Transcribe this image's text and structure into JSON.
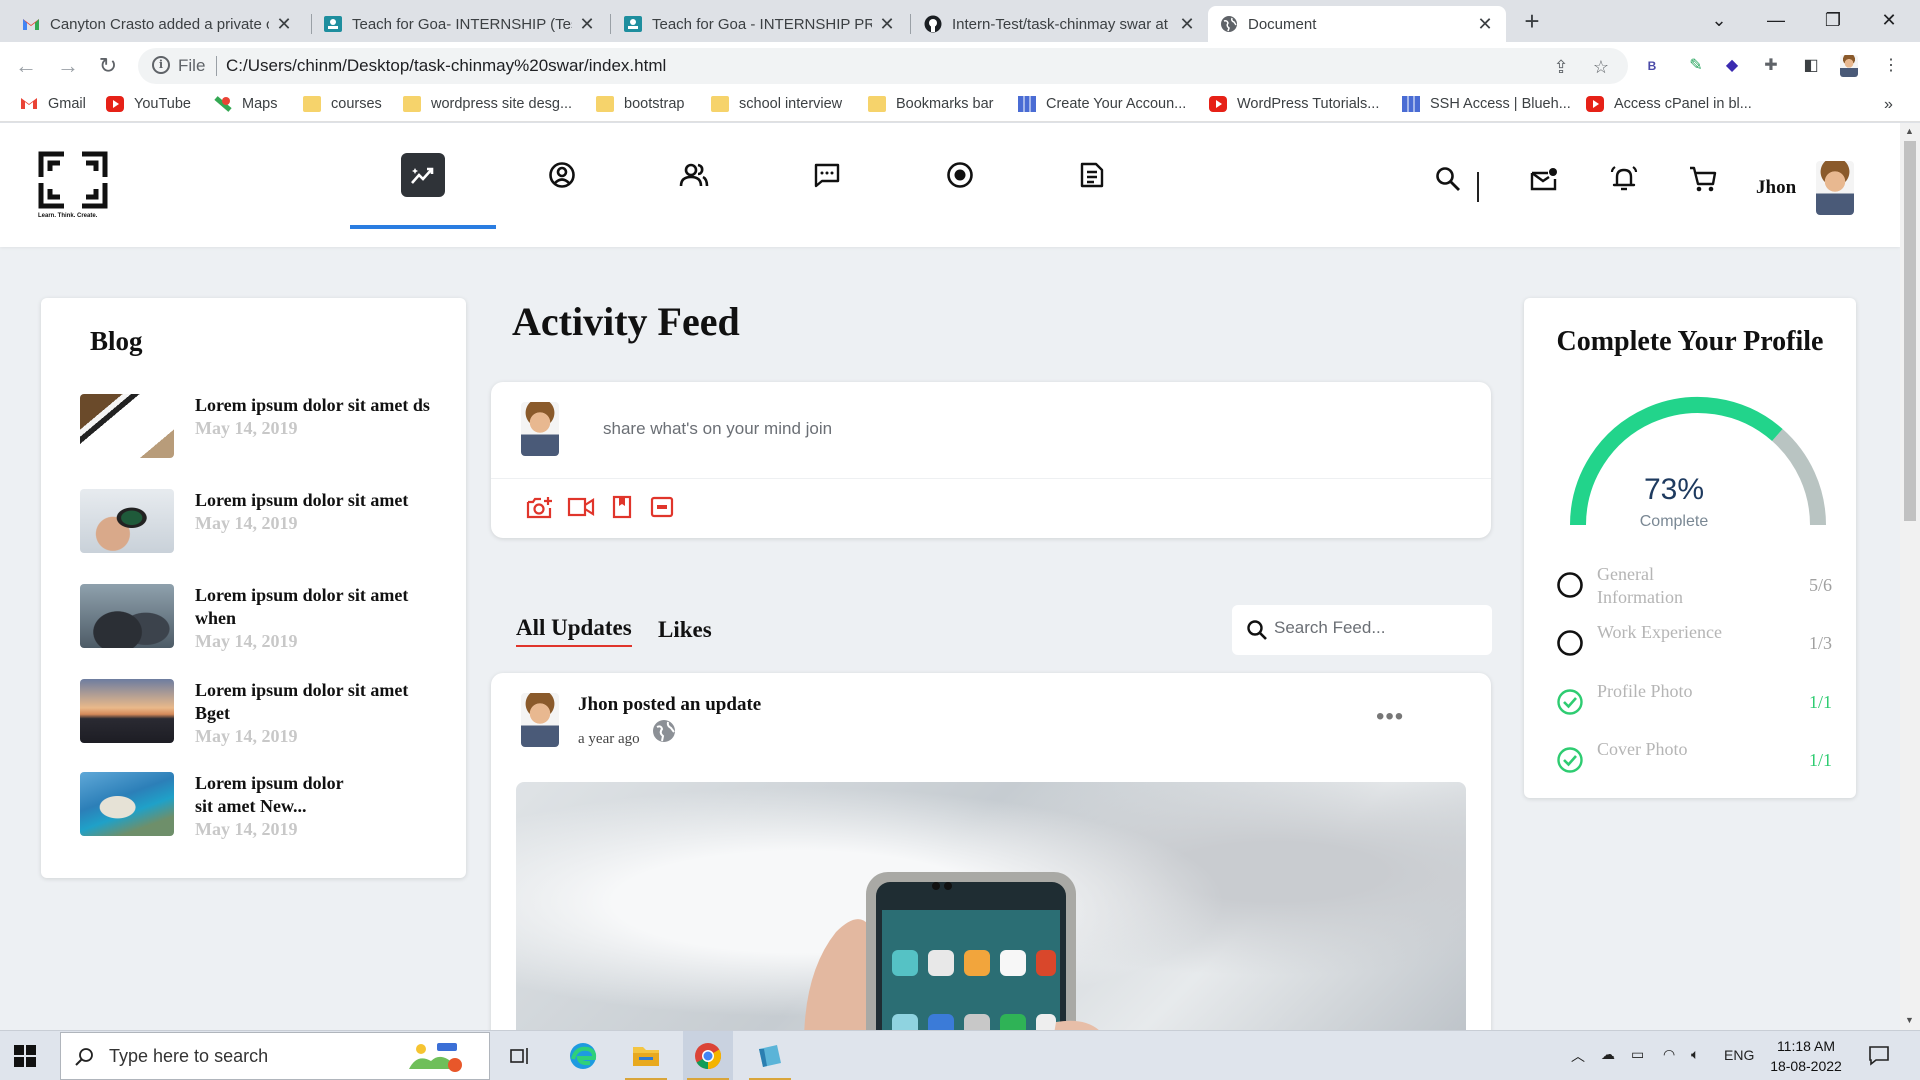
{
  "browser": {
    "tabs": [
      {
        "title": "Canyton Crasto added a private c",
        "icon": "gmail-icon",
        "active": false
      },
      {
        "title": "Teach for Goa- INTERNSHIP (Test",
        "icon": "classroom-icon",
        "active": false
      },
      {
        "title": "Teach for Goa - INTERNSHIP PRO",
        "icon": "classroom-icon",
        "active": false
      },
      {
        "title": "Intern-Test/task-chinmay swar at",
        "icon": "github-icon",
        "active": false
      },
      {
        "title": "Document",
        "icon": "globe-icon",
        "active": true
      }
    ],
    "file_label": "File",
    "url": "C:/Users/chinm/Desktop/task-chinmay%20swar/index.html",
    "bookmarks": [
      {
        "label": "Gmail",
        "icon": "gmail-icon"
      },
      {
        "label": "YouTube",
        "icon": "youtube-icon"
      },
      {
        "label": "Maps",
        "icon": "maps-icon"
      },
      {
        "label": "courses",
        "icon": "folder-icon"
      },
      {
        "label": "wordpress site desg...",
        "icon": "folder-icon"
      },
      {
        "label": "bootstrap",
        "icon": "folder-icon"
      },
      {
        "label": "school interview",
        "icon": "folder-icon"
      },
      {
        "label": "Bookmarks bar",
        "icon": "folder-icon"
      },
      {
        "label": "Create Your Accoun...",
        "icon": "grid-icon"
      },
      {
        "label": "WordPress Tutorials...",
        "icon": "youtube-icon"
      },
      {
        "label": "SSH Access | Blueh...",
        "icon": "grid-icon"
      },
      {
        "label": "Access cPanel in bl...",
        "icon": "youtube-icon"
      }
    ],
    "more_bookmarks": "»",
    "ext_b_label": "B"
  },
  "site": {
    "logo_tagline": "Learn. Think. Create.",
    "user_name": "Jhon",
    "nav": [
      "activity-icon",
      "user-circle-icon",
      "group-icon",
      "message-icon",
      "target-icon",
      "document-icon"
    ],
    "colors": {
      "accent": "#2a7de1",
      "danger": "#e0352b",
      "success": "#2ecc71",
      "gauge_fill": "#22d48b",
      "gauge_rest": "#b9c4c2"
    }
  },
  "blog": {
    "title": "Blog",
    "items": [
      {
        "title": "Lorem ipsum dolor sit amet ds",
        "date": "May 14, 2019"
      },
      {
        "title": "Lorem ipsum dolor sit amet",
        "date": "May 14, 2019"
      },
      {
        "title": "Lorem ipsum dolor sit amet when",
        "date": "May 14, 2019"
      },
      {
        "title": "Lorem ipsum dolor sit amet Bget",
        "date": "May 14, 2019"
      },
      {
        "title": "Lorem ipsum dolor sit amet New...",
        "date": "May 14, 2019"
      }
    ]
  },
  "feed": {
    "title": "Activity Feed",
    "composer_placeholder": "share what's on your mind join",
    "tab_all": "All Updates",
    "tab_likes": "Likes",
    "search_placeholder": "Search Feed...",
    "post": {
      "author_line": "Jhon posted an update",
      "time": "a year ago"
    }
  },
  "profile": {
    "title": "Complete Your Profile",
    "percent_text": "73%",
    "percent_value": 0.73,
    "complete_label": "Complete",
    "rows": [
      {
        "label": "General Information",
        "count": "5/6",
        "done": false
      },
      {
        "label": "Work Experience",
        "count": "1/3",
        "done": false
      },
      {
        "label": "Profile Photo",
        "count": "1/1",
        "done": true
      },
      {
        "label": "Cover Photo",
        "count": "1/1",
        "done": true
      }
    ]
  },
  "taskbar": {
    "search_placeholder": "Type here to search",
    "lang": "ENG",
    "time": "11:18 AM",
    "date": "18-08-2022"
  }
}
